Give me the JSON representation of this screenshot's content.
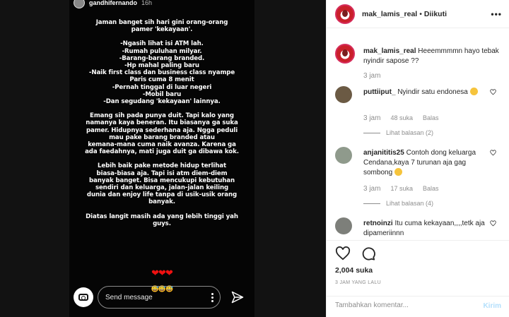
{
  "story": {
    "username": "gandhifernando",
    "time": "16h",
    "paragraphs": [
      [
        "Jaman banget sih hari gini orang-orang",
        "pamer 'kekayaan'."
      ],
      [
        "-Ngasih lihat isi ATM lah.",
        "-Rumah puluhan milyar.",
        "-Barang-barang branded.",
        "-Hp mahal paling baru",
        "-Naik first class dan business class nyampe",
        "Paris cuma 8 menit",
        "-Pernah tinggal di luar negeri",
        "-Mobil baru",
        "-Dan segudang 'kekayaan' lainnya."
      ],
      [
        "Emang sih pada punya duit. Tapi kalo yang",
        "namanya kaya beneran. Itu biasanya ga suka",
        "pamer. Hidupnya sederhana aja. Ngga peduli",
        "mau pake barang branded atau",
        "kemana-mana cuma naik avanza. Karena ga",
        "ada faedahnya, mati juga duit ga dibawa kok."
      ],
      [
        "Lebih baik pake metode hidup terlihat",
        "biasa-biasa aja. Tapi isi atm diem-diem",
        "banyak  banget. Bisa mencukupi kebutuhan",
        "sendiri dan keluarga, jalan-jalan keiling",
        "dunia dan enjoy life tanpa di usik-usik orang",
        "banyak."
      ],
      [
        "Diatas langit masih ada yang lebih tinggi yah",
        "guys."
      ]
    ],
    "hearts": "❤❤❤",
    "faces": "😅😅😅",
    "send_placeholder": "Send message"
  },
  "post": {
    "author": "mak_lamis_real",
    "separator": "•",
    "follow_status": "Diikuti",
    "more_label": "•••",
    "caption_author": "mak_lamis_real",
    "caption_text": "Heeemmmmn hayo tebak nyindir sapose ??",
    "caption_time": "3 jam",
    "comments": [
      {
        "user": "puttiiput_",
        "text": "Nyindir satu endonesa",
        "time": "3 jam",
        "likes": "48 suka",
        "reply": "Balas",
        "view_replies": "Lihat balasan (2)"
      },
      {
        "user": "anjanititis25",
        "text": "Contoh dong keluarga Cendana,kaya 7 turunan aja gag sombong",
        "time": "3 jam",
        "likes": "17 suka",
        "reply": "Balas",
        "view_replies": "Lihat balasan (4)"
      },
      {
        "user": "retnoinzi",
        "text": "Itu cuma kekayaan,,,,tetk aja dipameriinnn"
      }
    ],
    "likes_count": "2,004 suka",
    "posted_ago": "3 JAM YANG LALU",
    "add_comment_placeholder": "Tambahkan komentar...",
    "post_button": "Kirim"
  },
  "colors": {
    "accent_disabled": "#b2dffc",
    "muted": "#8e8e8e",
    "story_bg": "#050505"
  }
}
